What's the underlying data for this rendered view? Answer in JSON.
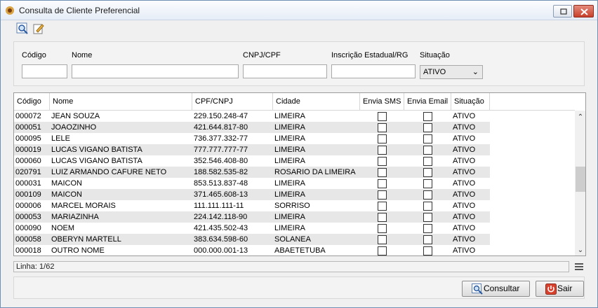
{
  "window": {
    "title": "Consulta de Cliente Preferencial"
  },
  "toolbar": {
    "icons": [
      "search-icon",
      "edit-icon"
    ]
  },
  "filters": {
    "codigo_label": "Código",
    "nome_label": "Nome",
    "cnpj_label": "CNPJ/CPF",
    "ie_label": "Inscrição Estadual/RG",
    "situacao_label": "Situação",
    "codigo_value": "",
    "nome_value": "",
    "cnpj_value": "",
    "ie_value": "",
    "situacao_value": "ATIVO"
  },
  "grid": {
    "headers": [
      "Código",
      "Nome",
      "CPF/CNPJ",
      "Cidade",
      "Envia SMS",
      "Envia Email",
      "Situação"
    ],
    "rows": [
      [
        "000072",
        "JEAN SOUZA",
        "229.150.248-47",
        "LIMEIRA",
        false,
        false,
        "ATIVO"
      ],
      [
        "000051",
        "JOAOZINHO",
        "421.644.817-80",
        "LIMEIRA",
        false,
        false,
        "ATIVO"
      ],
      [
        "000095",
        "LELE",
        "736.377.332-77",
        "LIMEIRA",
        false,
        false,
        "ATIVO"
      ],
      [
        "000019",
        "LUCAS VIGANO BATISTA",
        "777.777.777-77",
        "LIMEIRA",
        false,
        false,
        "ATIVO"
      ],
      [
        "000060",
        "LUCAS VIGANO BATISTA",
        "352.546.408-80",
        "LIMEIRA",
        false,
        false,
        "ATIVO"
      ],
      [
        "020791",
        "LUIZ ARMANDO CAFURE NETO",
        "188.582.535-82",
        "ROSARIO DA LIMEIRA",
        false,
        false,
        "ATIVO"
      ],
      [
        "000031",
        "MAICON",
        "853.513.837-48",
        "LIMEIRA",
        false,
        false,
        "ATIVO"
      ],
      [
        "000109",
        "MAICON",
        "371.465.608-13",
        "LIMEIRA",
        false,
        false,
        "ATIVO"
      ],
      [
        "000006",
        "MARCEL MORAIS",
        "111.111.111-11",
        "SORRISO",
        false,
        false,
        "ATIVO"
      ],
      [
        "000053",
        "MARIAZINHA",
        "224.142.118-90",
        "LIMEIRA",
        false,
        false,
        "ATIVO"
      ],
      [
        "000090",
        "NOEM",
        "421.435.502-43",
        "LIMEIRA",
        false,
        false,
        "ATIVO"
      ],
      [
        "000058",
        "OBERYN MARTELL",
        "383.634.598-60",
        "SOLANEA",
        false,
        false,
        "ATIVO"
      ],
      [
        "000018",
        "OUTRO NOME",
        "000.000.001-13",
        "ABAETETUBA",
        false,
        false,
        "ATIVO"
      ]
    ]
  },
  "status": {
    "linha": "Linha: 1/62"
  },
  "buttons": {
    "consultar": "Consultar",
    "sair": "Sair"
  }
}
